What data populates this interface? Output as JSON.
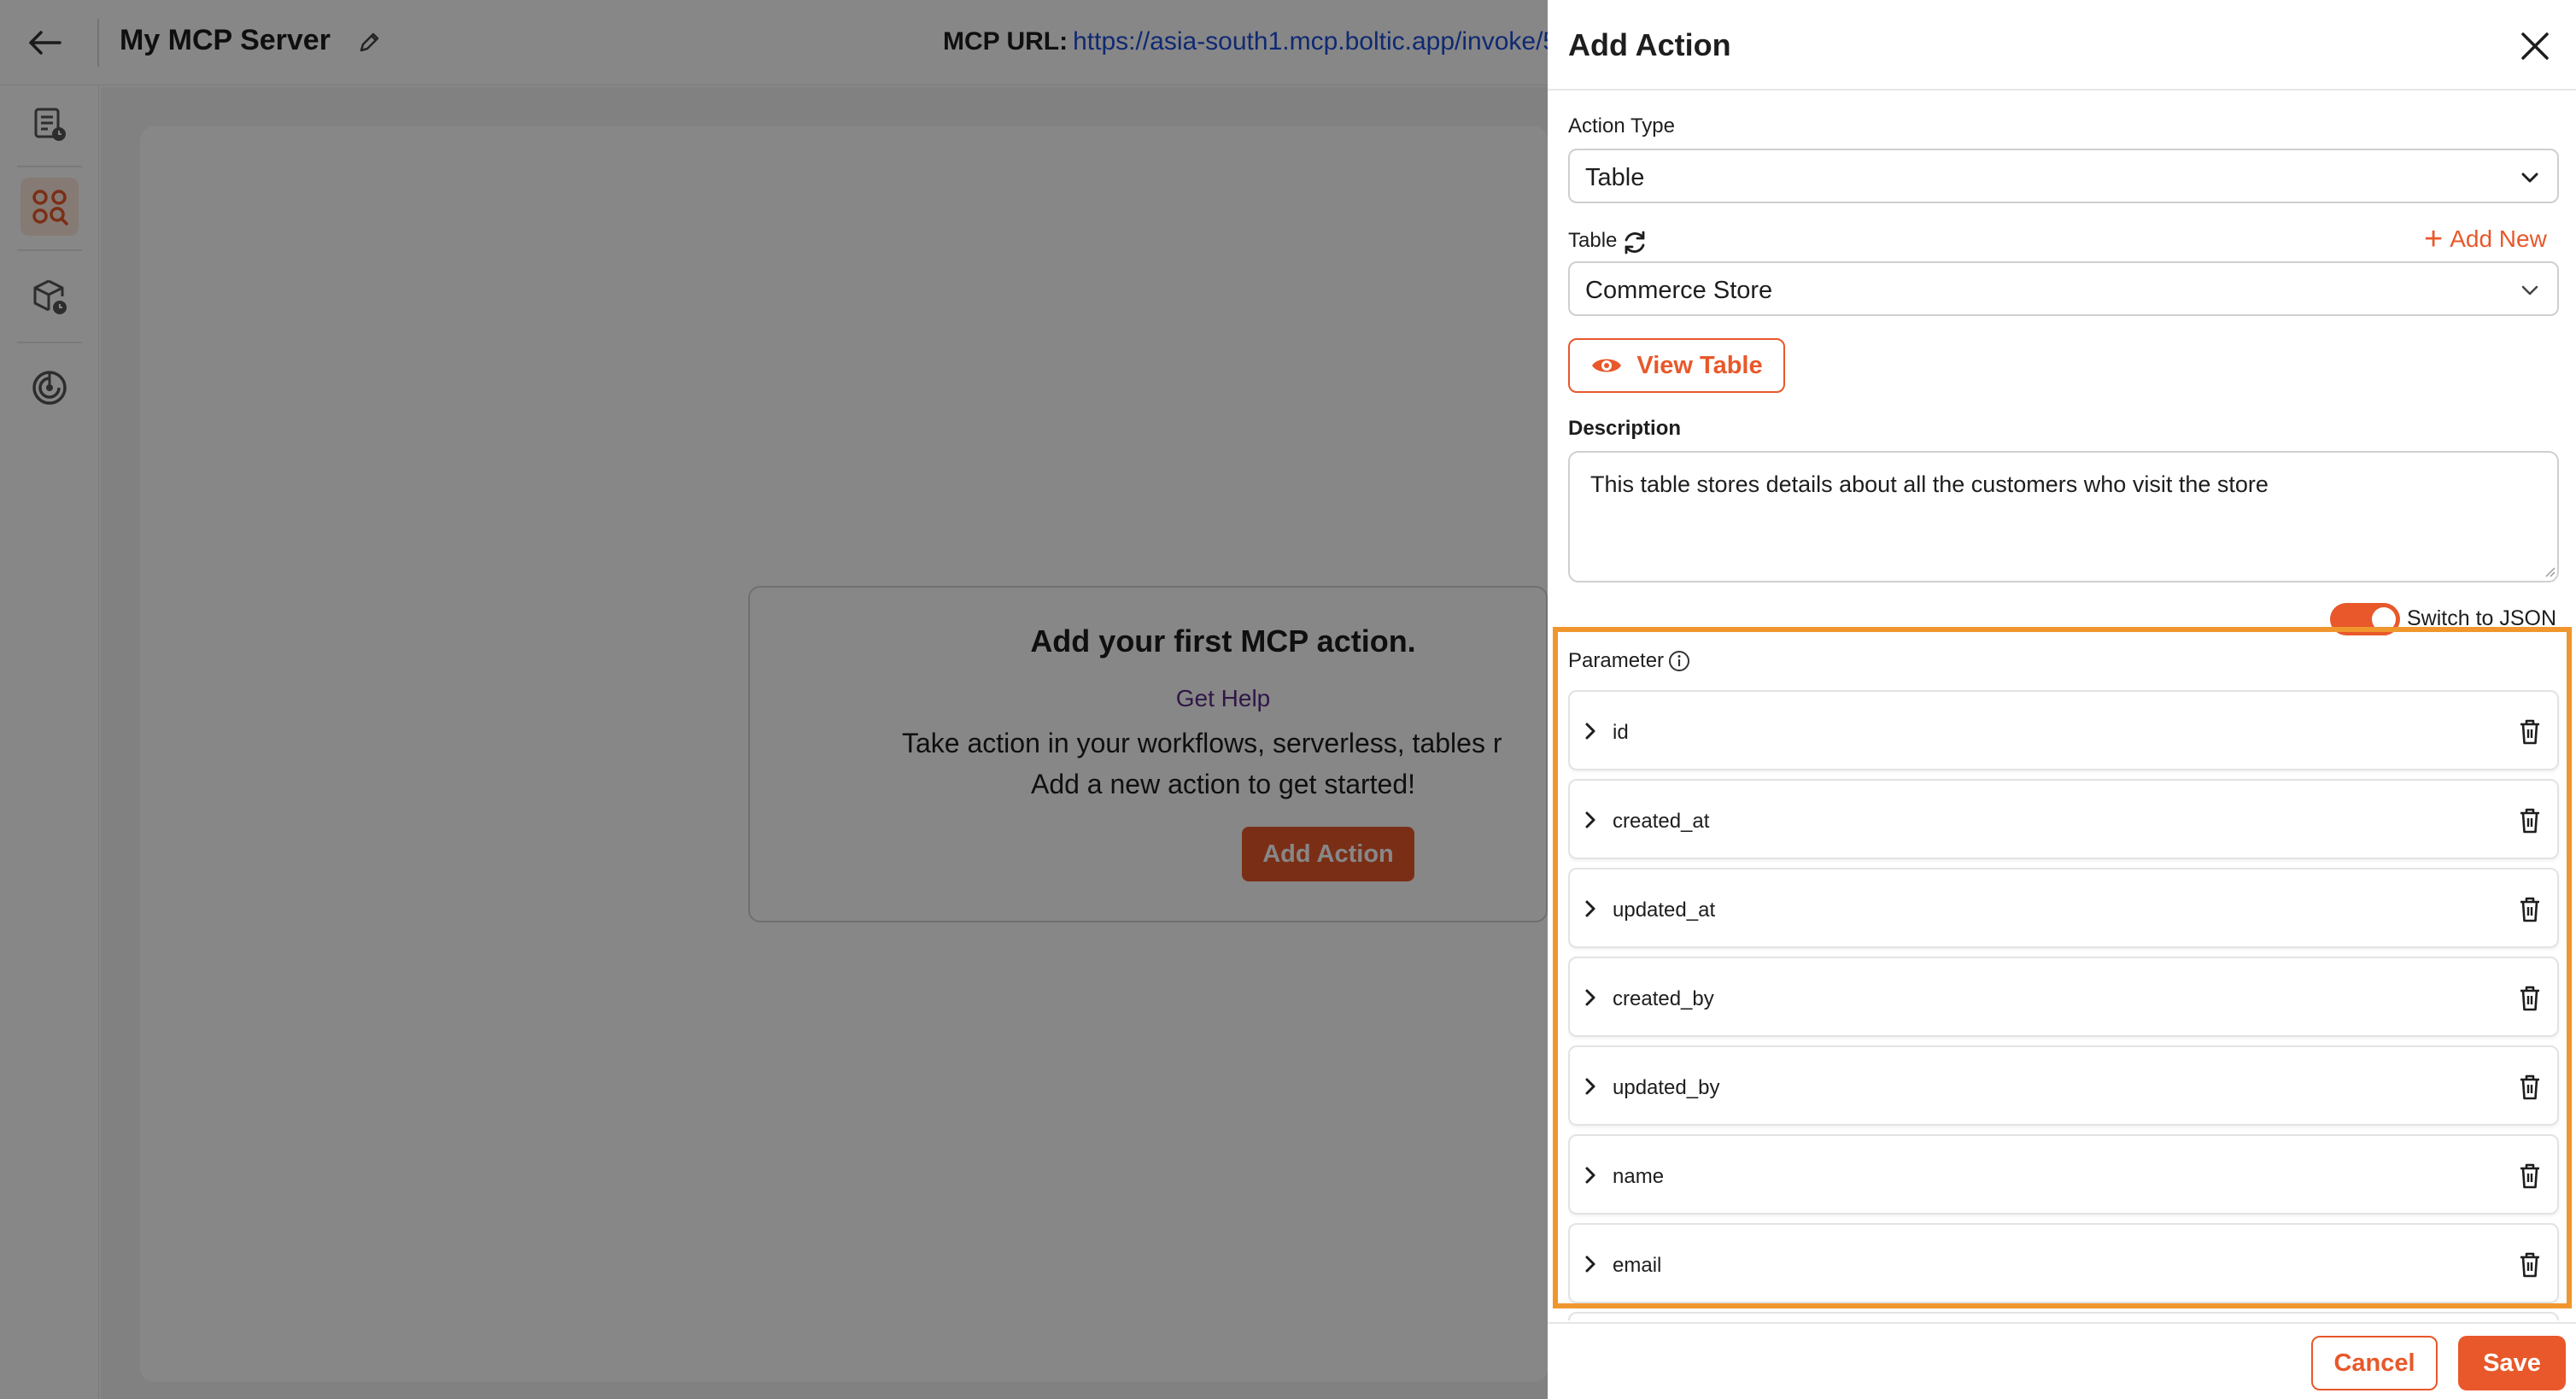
{
  "topbar": {
    "title": "My MCP Server",
    "mcp_url_label": "MCP URL:",
    "mcp_url_value": "https://asia-south1.mcp.boltic.app/invoke/5"
  },
  "sidebar": {
    "items": [
      {
        "icon": "document-clock-icon",
        "active": false
      },
      {
        "icon": "search-nodes-icon",
        "active": true
      },
      {
        "icon": "package-clock-icon",
        "active": false
      },
      {
        "icon": "radar-icon",
        "active": false
      }
    ]
  },
  "empty_state": {
    "title": "Add your first MCP action.",
    "help_link": "Get Help",
    "description_line1": "Take action in your workflows, serverless, tables r",
    "description_line2": "Add a new action to get started!",
    "button": "Add Action"
  },
  "drawer": {
    "title": "Add Action",
    "action_type_label": "Action Type",
    "action_type_value": "Table",
    "table_label": "Table",
    "add_new_label": "Add New",
    "table_value": "Commerce Store",
    "view_table_label": "View Table",
    "description_label": "Description",
    "description_value": "This table stores details about all the customers who visit the store",
    "switch_label": "Switch to JSON",
    "switch_on": true,
    "parameter_label": "Parameter",
    "parameters": [
      "id",
      "created_at",
      "updated_at",
      "created_by",
      "updated_by",
      "name",
      "email"
    ],
    "cancel_label": "Cancel",
    "save_label": "Save"
  },
  "colors": {
    "accent": "#e8582a",
    "highlight": "#f0962e",
    "link": "#1d4ed8",
    "help_link": "#5b2a86"
  }
}
